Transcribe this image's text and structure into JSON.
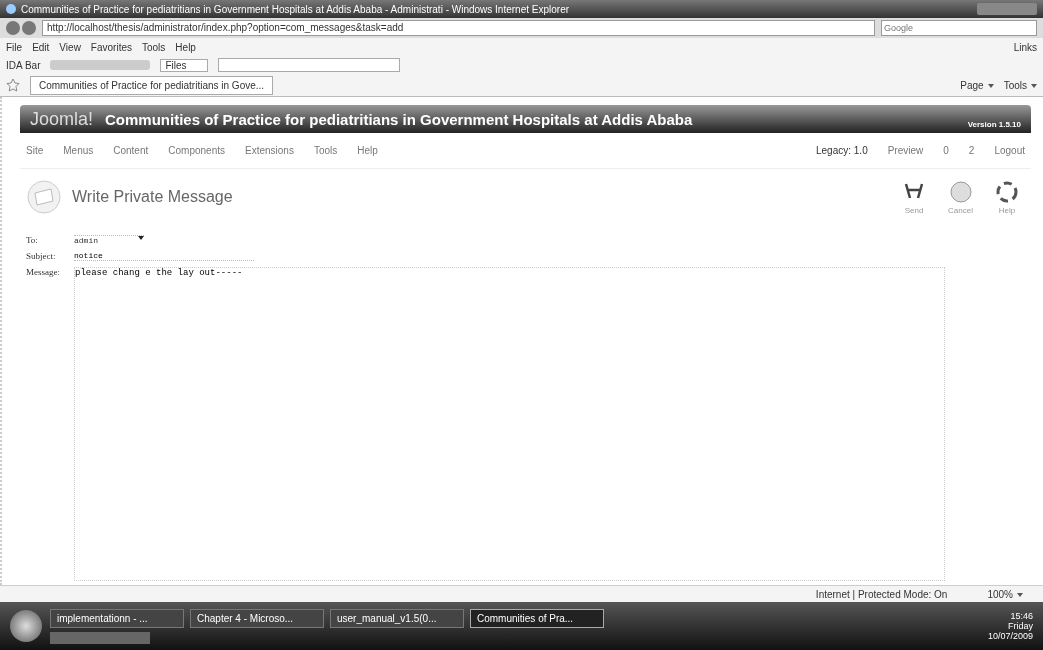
{
  "window": {
    "title": "Communities of Practice for pediatritians in Government Hospitals at Addis Ababa - Administrati - Windows Internet Explorer"
  },
  "address_bar": {
    "url": "http://localhost/thesis/administrator/index.php?option=com_messages&task=add",
    "search_placeholder": "Google"
  },
  "menu_bar": [
    "File",
    "Edit",
    "View",
    "Favorites",
    "Tools",
    "Help"
  ],
  "links_label": "Links",
  "ida_bar": {
    "label": "IDA Bar",
    "files_label": "Files"
  },
  "tabs": [
    {
      "label": "Communities of Practice for pediatritians in Gove...",
      "selected": true
    }
  ],
  "command_bar": [
    "Page",
    "Tools"
  ],
  "joomla": {
    "logo": "Joomla!",
    "site_title": "Communities of Practice for pediatritians in Government Hospitals at Addis Ababa",
    "version": "Version 1.5.10",
    "menu": [
      "Site",
      "Menus",
      "Content",
      "Components",
      "Extensions",
      "Tools",
      "Help"
    ],
    "status": {
      "legacy": "Legacy: 1.0",
      "preview": "Preview",
      "messages": "0",
      "users": "2",
      "logout": "Logout"
    },
    "page_title": "Write Private Message",
    "toolbar": [
      "Send",
      "Cancel",
      "Help"
    ],
    "form": {
      "to_label": "To:",
      "to_value": "admin",
      "subject_label": "Subject:",
      "subject_value": "notice",
      "message_label": "Message:",
      "message_value": "please chang e the lay out-----"
    }
  },
  "status_bar": {
    "zone": "Internet | Protected Mode: On",
    "zoom": "100%"
  },
  "taskbar": {
    "items": [
      {
        "label": "implementationn - ...",
        "selected": false
      },
      {
        "label": "Chapter 4 - Microso...",
        "selected": false
      },
      {
        "label": "user_manual_v1.5(0...",
        "selected": false
      },
      {
        "label": "Communities of Pra...",
        "selected": true
      }
    ],
    "time": "15:46",
    "day": "Friday",
    "date": "10/07/2009"
  }
}
